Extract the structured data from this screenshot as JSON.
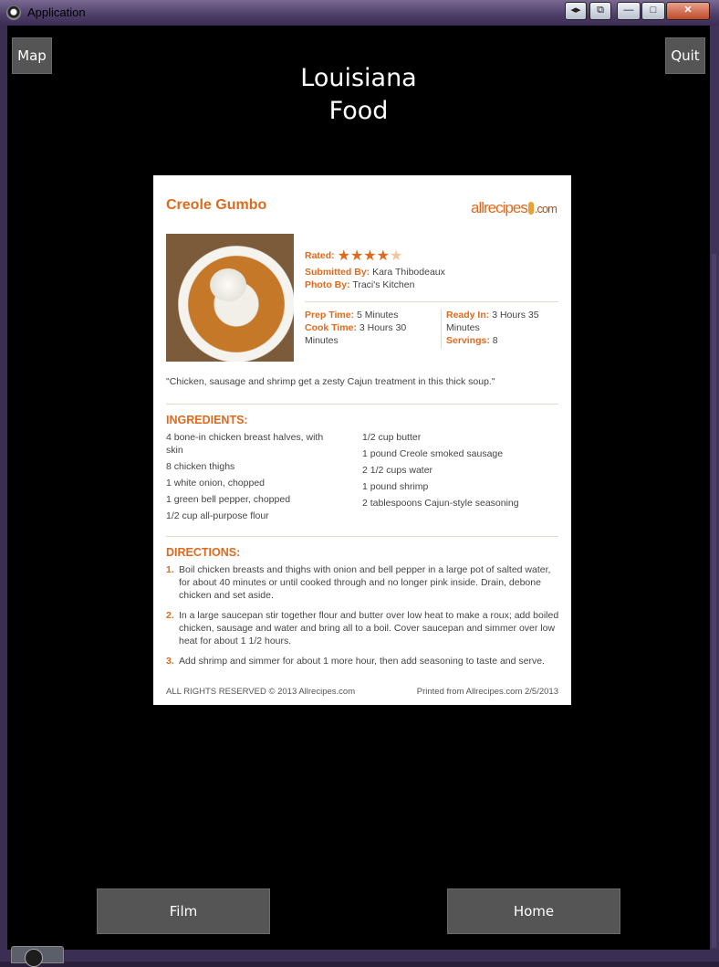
{
  "window": {
    "title": "Application",
    "controls": [
      "◂▸",
      "⧉",
      "—",
      "□",
      "✕"
    ]
  },
  "header": {
    "map_label": "Map",
    "quit_label": "Quit",
    "page_title_line1": "Louisiana",
    "page_title_line2": "Food"
  },
  "recipe": {
    "title": "Creole Gumbo",
    "logo_text_left": "allrecipes",
    "logo_text_right": ".com",
    "rated_label": "Rated:",
    "rating_stars": 4,
    "rating_max": 5,
    "submitted_by_label": "Submitted By:",
    "submitted_by": "Kara Thibodeaux",
    "photo_by_label": "Photo By:",
    "photo_by": "Traci's Kitchen",
    "prep_time_label": "Prep Time:",
    "prep_time": "5 Minutes",
    "cook_time_label": "Cook Time:",
    "cook_time": "3 Hours 30 Minutes",
    "ready_in_label": "Ready In:",
    "ready_in": "3 Hours 35 Minutes",
    "servings_label": "Servings:",
    "servings": "8",
    "quote": "\"Chicken, sausage and shrimp get a zesty Cajun treatment in this thick soup.\"",
    "ingredients_heading": "INGREDIENTS:",
    "ingredients_left": [
      "4 bone-in chicken breast halves, with skin",
      "8 chicken thighs",
      "1 white onion, chopped",
      "1 green bell pepper, chopped",
      "1/2 cup all-purpose flour"
    ],
    "ingredients_right": [
      "1/2 cup butter",
      "1 pound Creole smoked sausage",
      "2 1/2 cups water",
      "1 pound shrimp",
      "2 tablespoons Cajun-style seasoning"
    ],
    "directions_heading": "DIRECTIONS:",
    "directions": [
      {
        "num": "1.",
        "text": "Boil chicken breasts and thighs with onion and bell pepper in a large pot of salted water, for about 40 minutes or until cooked through and no longer pink inside. Drain, debone chicken and set aside."
      },
      {
        "num": "2.",
        "text": "In a large saucepan stir together flour and butter over low heat to make a roux; add boiled chicken, sausage and water and bring all to a boil. Cover saucepan and simmer over low heat for about 1 1/2 hours."
      },
      {
        "num": "3.",
        "text": "Add shrimp and simmer for about 1 more hour, then add seasoning to taste and serve."
      }
    ],
    "footer_left": "ALL RIGHTS RESERVED © 2013 Allrecipes.com",
    "footer_right": "Printed from Allrecipes.com 2/5/2013"
  },
  "footer": {
    "film_label": "Film",
    "home_label": "Home"
  },
  "colors": {
    "accent": "#e06a1c",
    "background": "#000000",
    "button": "#555555"
  }
}
